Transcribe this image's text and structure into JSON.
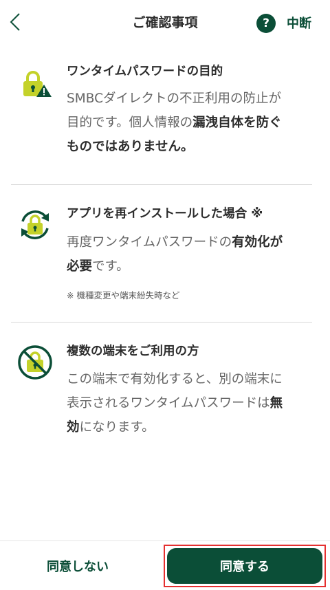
{
  "header": {
    "title": "ご確認事項",
    "help_label": "?",
    "suspend_label": "中断"
  },
  "sections": [
    {
      "title": "ワンタイムパスワードの目的",
      "body_line1": "SMBCダイレクトの不正利用の防止が",
      "body_line2_normal": "目的です。個人情報の",
      "body_line2_bold": "漏洩自体を防ぐ",
      "body_line3_bold": "ものではありません。",
      "icon": "lock-warning-icon"
    },
    {
      "title": "アプリを再インストールした場合 ※",
      "body_line1_normal": "再度ワンタイムパスワードの",
      "body_line1_bold": "有効化が",
      "body_line2_bold": "必要",
      "body_line2_normal": "です。",
      "note": "※ 機種変更や端末紛失時など",
      "icon": "lock-refresh-icon"
    },
    {
      "title": "複数の端末をご利用の方",
      "body_line1": "この端末で有効化すると、別の端末に",
      "body_line2_normal": "表示されるワンタイムパスワードは",
      "body_line2_bold": "無",
      "body_line3_bold": "効",
      "body_line3_normal": "になります。",
      "icon": "lock-prohibited-icon"
    }
  ],
  "footer": {
    "disagree_label": "同意しない",
    "agree_label": "同意する"
  },
  "colors": {
    "brand_green": "#0b4e37",
    "lime": "#c4d22a",
    "highlight_red": "#e53030"
  }
}
